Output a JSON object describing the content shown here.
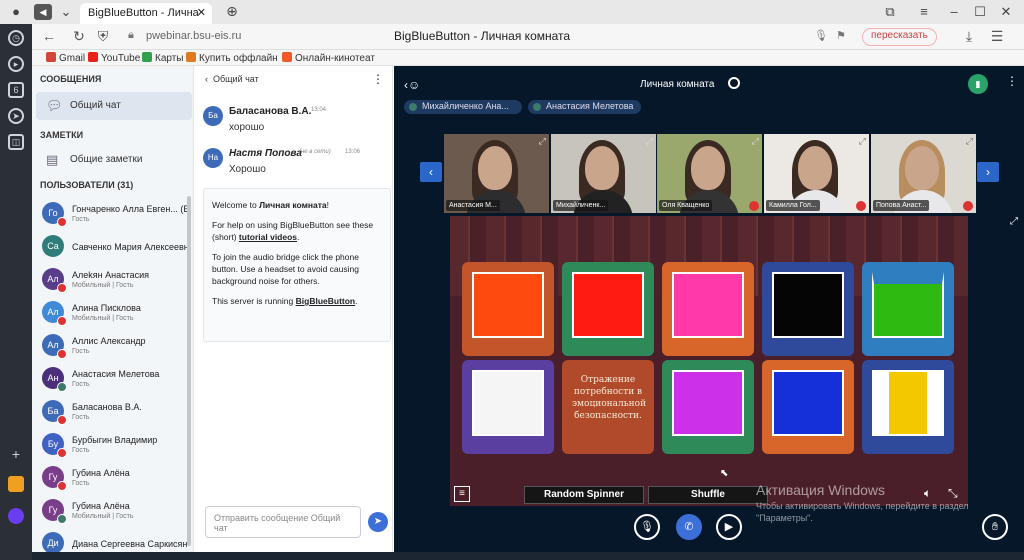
{
  "browser": {
    "tab_title": "BigBlueButton - Лична",
    "url_host": "pwebinar.bsu-eis.ru",
    "page_title": "BigBlueButton - Личная комната",
    "retell_label": "пересказать",
    "rail_badge": "6",
    "bookmarks": [
      {
        "label": "Gmail",
        "color": "#d44638"
      },
      {
        "label": "YouTube",
        "color": "#e62117"
      },
      {
        "label": "Карты",
        "color": "#31a24c"
      },
      {
        "label": "Купить оффлайн",
        "color": "#e07a22"
      },
      {
        "label": "Онлайн-кинотеат",
        "color": "#f05a28"
      }
    ]
  },
  "sidebar": {
    "messages_title": "СООБЩЕНИЯ",
    "public_chat_label": "Общий чат",
    "notes_title": "ЗАМЕТКИ",
    "shared_notes_label": "Общие заметки",
    "users_title": "ПОЛЬЗОВАТЕЛИ (31)",
    "users": [
      {
        "initials": "Го",
        "name": "Гончаренко Алла Евген... (Вы)",
        "role": "Гость",
        "color": "#3e6bb8"
      },
      {
        "initials": "Са",
        "name": "Савченко Мария Алексеевна",
        "role": "",
        "color": "#2f7d7a"
      },
      {
        "initials": "Ал",
        "name": "Алеkян Анастасия",
        "role": "Мобильный | Гость",
        "color": "#5a3d8a"
      },
      {
        "initials": "Ал",
        "name": "Алина Писклова",
        "role": "Мобильный | Гость",
        "color": "#3e8ad6"
      },
      {
        "initials": "Ал",
        "name": "Аллис Александр",
        "role": "Гость",
        "color": "#3e6bb8"
      },
      {
        "initials": "Ан",
        "name": "Анастасия Мелетова",
        "role": "Гость",
        "color": "#4b2f7a"
      },
      {
        "initials": "Ба",
        "name": "Баласанова В.А.",
        "role": "Гость",
        "color": "#3e6bb8"
      },
      {
        "initials": "Бу",
        "name": "Бурбыгин Владимир",
        "role": "Гость",
        "color": "#3f61c4"
      },
      {
        "initials": "Гу",
        "name": "Губина Алёна",
        "role": "Гость",
        "color": "#7a3d8a"
      },
      {
        "initials": "Гу",
        "name": "Губина Алёна",
        "role": "Мобильный | Гость",
        "color": "#7a3d8a"
      },
      {
        "initials": "Ди",
        "name": "Диана Сергеевна Саркисян",
        "role": "",
        "color": "#3e6bb8"
      }
    ]
  },
  "chat": {
    "header": "Общий чат",
    "messages": [
      {
        "initials": "Ба",
        "name": "Баласанова В.А.",
        "time": "13:04",
        "text": "хорошо",
        "color": "#3e6bb8"
      },
      {
        "initials": "На",
        "name": "Настя Попова",
        "away": "(не в сети)",
        "time": "13:06",
        "text": "Хорошо",
        "color": "#3e6bb8"
      }
    ],
    "welcome_title_prefix": "Welcome to ",
    "welcome_room": "Личная комната",
    "welcome_title_suffix": "!",
    "welcome_help_prefix": "For help on using BigBlueButton see these (short) ",
    "welcome_help_link": "tutorial videos",
    "welcome_help_suffix": ".",
    "welcome_audio": "To join the audio bridge click the phone button. Use a headset to avoid causing background noise for others.",
    "welcome_server_prefix": "This server is running ",
    "welcome_server_link": "BigBlueButton",
    "welcome_server_suffix": ".",
    "input_placeholder": "Отправить сообщение Общий чат"
  },
  "main": {
    "room_title": "Личная комната",
    "talking": [
      "Михайличенко Ана...",
      "Анастасия Мелетова"
    ],
    "cameras": [
      {
        "name": "Анастасия М..."
      },
      {
        "name": "Михайличенк..."
      },
      {
        "name": "Оля Кващенко"
      },
      {
        "name": "Камилла Гол..."
      },
      {
        "name": "Попова Анаст..."
      }
    ],
    "books": [
      {
        "frame": "#c2552a",
        "fill": "#ff4a0f"
      },
      {
        "frame": "#2f8a5a",
        "fill": "#ff1a12"
      },
      {
        "frame": "#d8662a",
        "fill": "#ff3aa8"
      },
      {
        "frame": "#2f4a9a",
        "fill": "#050505"
      },
      {
        "frame": "#2f7fc0",
        "fill": "#2fba12"
      },
      {
        "frame": "#5a3fa0",
        "fill": "#f5f5f5"
      },
      {
        "frame": "#b04a2a",
        "fill": "",
        "text": "Отражение потребности в эмоциональной безопасности."
      },
      {
        "frame": "#2f8a5a",
        "fill": "#cc30e8"
      },
      {
        "frame": "#d8662a",
        "fill": "#1530d8"
      },
      {
        "frame": "#2f4a9a",
        "fill": "#f3c800"
      }
    ],
    "random_spinner": "Random Spinner",
    "shuffle": "Shuffle",
    "activation_title": "Активация Windows",
    "activation_text": "Чтобы активировать Windows, перейдите в раздел \"Параметры\"."
  }
}
